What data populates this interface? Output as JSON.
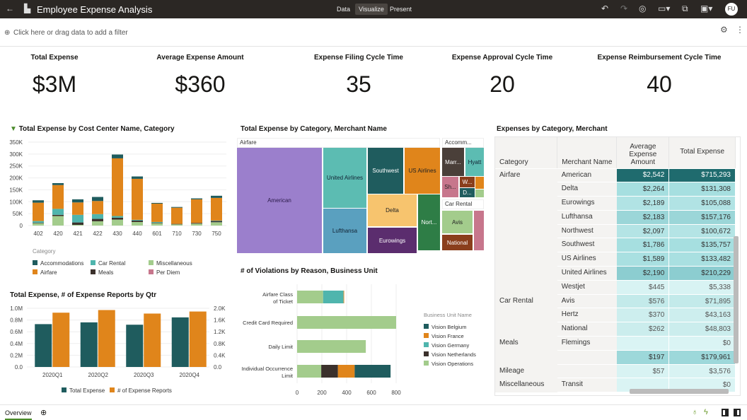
{
  "header": {
    "title": "Employee Expense Analysis",
    "tabs": [
      "Data",
      "Visualize",
      "Present"
    ],
    "active_tab": "Visualize",
    "avatar": "FU"
  },
  "filter": {
    "placeholder": "Click here or drag data to add a filter"
  },
  "kpis": [
    {
      "label": "Total Expense",
      "value": "$3M"
    },
    {
      "label": "Average Expense Amount",
      "value": "$360"
    },
    {
      "label": "Expense Filing Cycle Time",
      "value": "35"
    },
    {
      "label": "Expense Approval Cycle Time",
      "value": "20"
    },
    {
      "label": "Expense Reimbursement Cycle Time",
      "value": "40"
    }
  ],
  "colors": {
    "Accommodations": "#1f5c5e",
    "Airfare": "#e0851b",
    "Car Rental": "#4fb5ad",
    "Meals": "#3b312c",
    "Miscellaneous": "#a3cc8c",
    "Per Diem": "#c7768c"
  },
  "chart_data": [
    {
      "type": "bar",
      "stacked": true,
      "title": "Total Expense by Cost Center Name, Category",
      "categories": [
        "402",
        "420",
        "421",
        "422",
        "430",
        "440",
        "601",
        "710",
        "730",
        "750"
      ],
      "ylim": [
        0,
        350000
      ],
      "yticks": [
        "0",
        "50K",
        "100K",
        "150K",
        "200K",
        "250K",
        "300K",
        "350K"
      ],
      "legend_title": "Category",
      "legend": [
        "Accommodations",
        "Car Rental",
        "Miscellaneous",
        "Airfare",
        "Meals",
        "Per Diem"
      ],
      "legend_placement": "bottom",
      "series": [
        {
          "name": "Miscellaneous",
          "values": [
            10000,
            40000,
            3000,
            18000,
            25000,
            15000,
            10000,
            5000,
            8000,
            14000
          ]
        },
        {
          "name": "Meals",
          "values": [
            2000,
            5000,
            10000,
            10000,
            8000,
            6000,
            2000,
            2000,
            3000,
            5000
          ]
        },
        {
          "name": "Car Rental",
          "values": [
            7000,
            25000,
            32000,
            20000,
            7000,
            3000,
            3000,
            0,
            0,
            2000
          ]
        },
        {
          "name": "Airfare",
          "values": [
            77000,
            100000,
            52000,
            55000,
            242000,
            172000,
            77000,
            68000,
            99000,
            95000
          ]
        },
        {
          "name": "Accommodations",
          "values": [
            10000,
            8000,
            13000,
            17000,
            16000,
            10000,
            3000,
            3000,
            4000,
            9000
          ]
        }
      ]
    },
    {
      "type": "bar",
      "title": "Total Expense, # of Expense Reports by Qtr",
      "categories": [
        "2020Q1",
        "2020Q2",
        "2020Q3",
        "2020Q4"
      ],
      "ylim": [
        0,
        1000000
      ],
      "yticks": [
        "0.0",
        "0.2M",
        "0.4M",
        "0.6M",
        "0.8M",
        "1.0M"
      ],
      "y2lim": [
        0,
        2000
      ],
      "y2ticks": [
        "0.0",
        "0.4K",
        "0.8K",
        "1.2K",
        "1.6K",
        "2.0K"
      ],
      "legend_placement": "bottom",
      "series": [
        {
          "name": "Total Expense",
          "axis": "y",
          "color": "#1f5c5e",
          "values": [
            730000,
            760000,
            720000,
            845000
          ]
        },
        {
          "name": "# of Expense Reports",
          "axis": "y2",
          "color": "#e0851b",
          "values": [
            1850,
            1940,
            1820,
            1890
          ]
        }
      ]
    },
    {
      "type": "bar",
      "orientation": "horizontal",
      "stacked": true,
      "title": "# of Violations by Reason, Business Unit",
      "categories": [
        "Airfare Class of Ticket",
        "Credit Card Required",
        "Daily Limit",
        "Individual Occurrence Limit"
      ],
      "xlim": [
        0,
        800
      ],
      "xticks": [
        "0",
        "200",
        "400",
        "600",
        "800"
      ],
      "legend_title": "Business Unit Name",
      "legend_placement": "right",
      "series": [
        {
          "name": "Vision Operations",
          "color": "#a3cc8c",
          "values": [
            210,
            800,
            555,
            195
          ]
        },
        {
          "name": "Vision Germany",
          "color": "#4fb5ad",
          "values": [
            165,
            0,
            0,
            0
          ]
        },
        {
          "name": "Vision Netherlands",
          "color": "#3b312c",
          "values": [
            0,
            0,
            0,
            135
          ]
        },
        {
          "name": "Vision France",
          "color": "#e0851b",
          "values": [
            5,
            0,
            0,
            135
          ]
        },
        {
          "name": "Vision Belgium",
          "color": "#1f5c5e",
          "values": [
            0,
            0,
            0,
            290
          ]
        }
      ],
      "legend": [
        "Vision Belgium",
        "Vision France",
        "Vision Germany",
        "Vision Netherlands",
        "Vision Operations"
      ]
    }
  ],
  "treemap": {
    "title": "Total Expense by Category, Merchant Name",
    "groups": [
      "Airfare",
      "Accomm...",
      "Car Rental"
    ],
    "tiles": [
      {
        "label": "American",
        "color": "#9b7fcc",
        "text": "#2b1a4a"
      },
      {
        "label": "United Airlines",
        "color": "#5cbcb2",
        "text": "#123"
      },
      {
        "label": "Lufthansa",
        "color": "#5aa0bf",
        "text": "#123"
      },
      {
        "label": "Southwest",
        "color": "#1f5c5e",
        "text": "#fff"
      },
      {
        "label": "US Airlines",
        "color": "#e0851b",
        "text": "#222"
      },
      {
        "label": "Delta",
        "color": "#f7c46e",
        "text": "#222"
      },
      {
        "label": "Eurowings",
        "color": "#5b2d6e",
        "text": "#fff"
      },
      {
        "label": "Nort...",
        "color": "#2e7d46",
        "text": "#fff"
      },
      {
        "label": "Marr...",
        "color": "#4a3f39",
        "text": "#fff"
      },
      {
        "label": "Hyatt",
        "color": "#5cbcb2",
        "text": "#123"
      },
      {
        "label": "Sh...",
        "color": "#c7768c",
        "text": "#222"
      },
      {
        "label": "W...",
        "color": "#8a3e1c",
        "text": "#fff"
      },
      {
        "label": "D...",
        "color": "#1f5c5e",
        "text": "#fff"
      },
      {
        "label": "",
        "color": "#e0851b",
        "text": "#fff"
      },
      {
        "label": "",
        "color": "#a3cc8c",
        "text": "#fff"
      },
      {
        "label": "Avis",
        "color": "#a3cc8c",
        "text": "#222"
      },
      {
        "label": "National",
        "color": "#8a3e1c",
        "text": "#fff"
      },
      {
        "label": "",
        "color": "#c7768c",
        "text": "#fff"
      }
    ]
  },
  "table": {
    "title": "Expenses by Category, Merchant",
    "columns": [
      "Category",
      "Merchant Name",
      "Average Expense Amount",
      "Total Expense"
    ],
    "rows": [
      {
        "cat": "Airfare",
        "merchant": "American",
        "avg": "$2,542",
        "total": "$715,293",
        "bg": "#1f6b6e",
        "fg": "#fff"
      },
      {
        "cat": "",
        "merchant": "Delta",
        "avg": "$2,264",
        "total": "$131,308",
        "bg": "#a6dfe0",
        "fg": "#333"
      },
      {
        "cat": "",
        "merchant": "Eurowings",
        "avg": "$2,189",
        "total": "$105,088",
        "bg": "#b1e3e4",
        "fg": "#333"
      },
      {
        "cat": "",
        "merchant": "Lufthansa",
        "avg": "$2,183",
        "total": "$157,176",
        "bg": "#9bd6d8",
        "fg": "#333"
      },
      {
        "cat": "",
        "merchant": "Northwest",
        "avg": "$2,097",
        "total": "$100,672",
        "bg": "#b4e4e5",
        "fg": "#333"
      },
      {
        "cat": "",
        "merchant": "Southwest",
        "avg": "$1,786",
        "total": "$135,757",
        "bg": "#a6dfe0",
        "fg": "#333"
      },
      {
        "cat": "",
        "merchant": "US Airlines",
        "avg": "$1,589",
        "total": "$133,482",
        "bg": "#a9e0e1",
        "fg": "#333"
      },
      {
        "cat": "",
        "merchant": "United Airlines",
        "avg": "$2,190",
        "total": "$210,229",
        "bg": "#8ccdd0",
        "fg": "#333"
      },
      {
        "cat": "",
        "merchant": "Westjet",
        "avg": "$445",
        "total": "$5,338",
        "bg": "#d8f3f3",
        "fg": "#555"
      },
      {
        "cat": "Car Rental",
        "merchant": "Avis",
        "avg": "$576",
        "total": "$71,895",
        "bg": "#c3eaea",
        "fg": "#555"
      },
      {
        "cat": "",
        "merchant": "Hertz",
        "avg": "$370",
        "total": "$43,163",
        "bg": "#cdeeee",
        "fg": "#555"
      },
      {
        "cat": "",
        "merchant": "National",
        "avg": "$262",
        "total": "$48,803",
        "bg": "#cbeded",
        "fg": "#555"
      },
      {
        "cat": "Meals",
        "merchant": "Flemings",
        "avg": "",
        "total": "$0",
        "bg": "#daf4f4",
        "fg": "#555"
      },
      {
        "cat": "",
        "merchant": "",
        "avg": "$197",
        "total": "$179,961",
        "bg": "#9dd8da",
        "fg": "#333"
      },
      {
        "cat": "Mileage",
        "merchant": "",
        "avg": "$57",
        "total": "$3,576",
        "bg": "#d8f3f3",
        "fg": "#555"
      },
      {
        "cat": "Miscellaneous",
        "merchant": "Transit",
        "avg": "",
        "total": "$0",
        "bg": "#daf4f4",
        "fg": "#555"
      }
    ]
  },
  "footer": {
    "tab": "Overview"
  }
}
